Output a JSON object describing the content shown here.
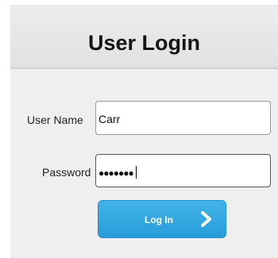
{
  "login": {
    "title": "User Login",
    "username": {
      "label": "User Name",
      "value": "Carr"
    },
    "password": {
      "label": "Password",
      "masked_value": "●●●●●●●"
    },
    "submit": {
      "label": "Log In",
      "icon": "chevron-right-icon"
    }
  },
  "colors": {
    "button": "#2ea6e0",
    "panel": "#efefef",
    "header": "#e5e5e5"
  }
}
